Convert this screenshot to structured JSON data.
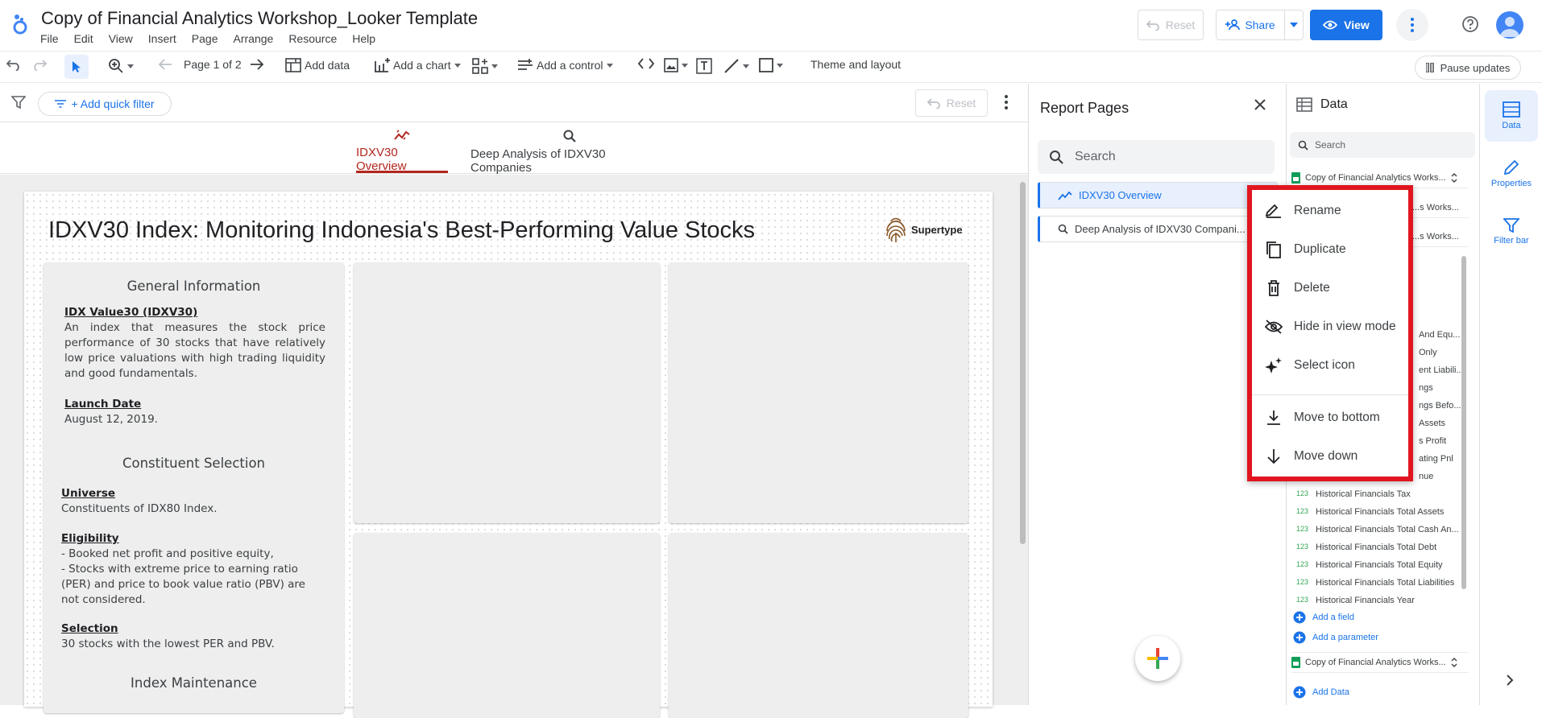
{
  "header": {
    "doc_title": "Copy of Financial Analytics Workshop_Looker Template",
    "menu": [
      "File",
      "Edit",
      "View",
      "Insert",
      "Page",
      "Arrange",
      "Resource",
      "Help"
    ],
    "reset_label": "Reset",
    "share_label": "Share",
    "view_label": "View"
  },
  "toolbar": {
    "page_indicator": "Page 1 of 2",
    "add_data": "Add data",
    "add_chart": "Add a chart",
    "add_control": "Add a control",
    "theme_layout": "Theme and layout",
    "pause_updates": "Pause updates"
  },
  "filter_bar": {
    "quick_filter": "+ Add quick filter",
    "reset_label": "Reset"
  },
  "page_tabs": [
    {
      "label": "IDXV30 Overview",
      "icon": "trend-icon",
      "active": true
    },
    {
      "label": "Deep Analysis of IDXV30 Companies",
      "icon": "search-icon",
      "active": false
    }
  ],
  "report": {
    "title": "IDXV30 Index: Monitoring Indonesia's Best-Performing Value Stocks",
    "brand": "Supertype",
    "info": {
      "general_heading": "General Information",
      "idx_title": "IDX Value30 (IDXV30)",
      "idx_desc": "An index that measures the stock price performance of 30 stocks that have relatively low price valuations with high trading liquidity and good fundamentals.",
      "launch_title": "Launch Date",
      "launch_value": "August 12, 2019.",
      "constituent_heading": "Constituent Selection",
      "universe_title": "Universe",
      "universe_value": "Constituents of IDX80 Index.",
      "eligibility_title": "Eligibility",
      "eligibility_1": "- Booked net profit and positive equity,",
      "eligibility_2": "- Stocks with extreme price to earning ratio (PER) and price to book value ratio (PBV) are not considered.",
      "selection_title": "Selection",
      "selection_value": "30 stocks with the lowest PER and PBV.",
      "maintenance_heading": "Index Maintenance"
    }
  },
  "report_pages": {
    "title": "Report Pages",
    "search_placeholder": "Search",
    "pages": [
      "IDXV30 Overview",
      "Deep Analysis of IDXV30 Compani..."
    ]
  },
  "data_panel": {
    "title": "Data",
    "search_placeholder": "Search",
    "sources": [
      "Copy of Financial Analytics Works...",
      "Copy of Financial Analytics Works..."
    ],
    "partial_fields": [
      "...s Works...",
      "...s Works...",
      "And Equ...",
      "Only",
      "ent Liabili...",
      "ngs",
      "ngs Befo...",
      "Assets",
      "s Profit",
      "ating Pnl",
      "nue"
    ],
    "fields": [
      "Historical Financials Tax",
      "Historical Financials Total Assets",
      "Historical Financials Total Cash An...",
      "Historical Financials Total Debt",
      "Historical Financials Total Equity",
      "Historical Financials Total Liabilities",
      "Historical Financials Year"
    ],
    "field_type": "123",
    "add_field": "Add a field",
    "add_parameter": "Add a parameter",
    "add_data": "Add Data"
  },
  "rail": [
    "Data",
    "Properties",
    "Filter bar"
  ],
  "context_menu": [
    {
      "label": "Rename",
      "icon": "rename-icon"
    },
    {
      "label": "Duplicate",
      "icon": "duplicate-icon"
    },
    {
      "label": "Delete",
      "icon": "delete-icon"
    },
    {
      "label": "Hide in view mode",
      "icon": "hide-icon"
    },
    {
      "label": "Select icon",
      "icon": "sparkle-icon"
    },
    {
      "label": "Move to bottom",
      "icon": "move-to-bottom-icon"
    },
    {
      "label": "Move down",
      "icon": "arrow-down-icon"
    }
  ],
  "colors": {
    "accent": "#1a73e8",
    "active_tab": "#b3261e",
    "highlight_box": "#e0151f"
  }
}
